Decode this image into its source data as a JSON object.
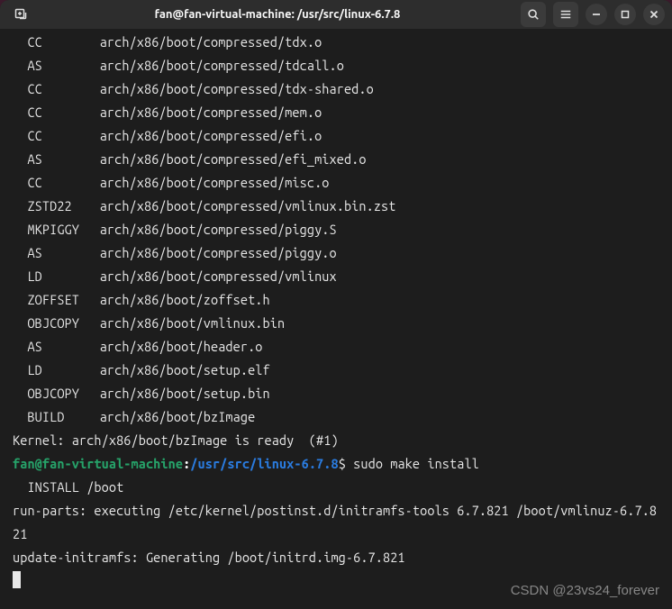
{
  "titlebar": {
    "title": "fan@fan-virtual-machine: /usr/src/linux-6.7.8"
  },
  "build_lines": [
    {
      "tag": "CC",
      "path": "arch/x86/boot/compressed/tdx.o"
    },
    {
      "tag": "AS",
      "path": "arch/x86/boot/compressed/tdcall.o"
    },
    {
      "tag": "CC",
      "path": "arch/x86/boot/compressed/tdx-shared.o"
    },
    {
      "tag": "CC",
      "path": "arch/x86/boot/compressed/mem.o"
    },
    {
      "tag": "CC",
      "path": "arch/x86/boot/compressed/efi.o"
    },
    {
      "tag": "AS",
      "path": "arch/x86/boot/compressed/efi_mixed.o"
    },
    {
      "tag": "CC",
      "path": "arch/x86/boot/compressed/misc.o"
    },
    {
      "tag": "ZSTD22",
      "path": "arch/x86/boot/compressed/vmlinux.bin.zst"
    },
    {
      "tag": "MKPIGGY",
      "path": "arch/x86/boot/compressed/piggy.S"
    },
    {
      "tag": "AS",
      "path": "arch/x86/boot/compressed/piggy.o"
    },
    {
      "tag": "LD",
      "path": "arch/x86/boot/compressed/vmlinux"
    },
    {
      "tag": "ZOFFSET",
      "path": "arch/x86/boot/zoffset.h"
    },
    {
      "tag": "OBJCOPY",
      "path": "arch/x86/boot/vmlinux.bin"
    },
    {
      "tag": "AS",
      "path": "arch/x86/boot/header.o"
    },
    {
      "tag": "LD",
      "path": "arch/x86/boot/setup.elf"
    },
    {
      "tag": "OBJCOPY",
      "path": "arch/x86/boot/setup.bin"
    },
    {
      "tag": "BUILD",
      "path": "arch/x86/boot/bzImage"
    }
  ],
  "kernel_ready": "Kernel: arch/x86/boot/bzImage is ready  (#1)",
  "prompt": {
    "user": "fan@fan-virtual-machine",
    "colon": ":",
    "path": "/usr/src/linux-6.7.8",
    "sep": "$ ",
    "cmd": "sudo make install"
  },
  "post_lines": [
    "  INSTALL /boot",
    "run-parts: executing /etc/kernel/postinst.d/initramfs-tools 6.7.821 /boot/vmlinuz-6.7.821",
    "update-initramfs: Generating /boot/initrd.img-6.7.821"
  ],
  "watermark": "CSDN @23vs24_forever"
}
